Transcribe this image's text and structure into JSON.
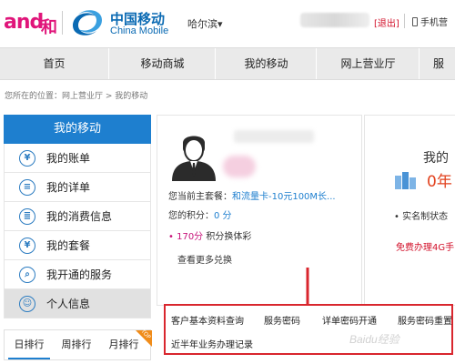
{
  "header": {
    "and_logo": "and",
    "he_text": "和",
    "brand_cn": "中国移动",
    "brand_en": "China Mobile",
    "city": "哈尔滨",
    "city_caret": "▾",
    "logout": "[退出]",
    "phone_link": "手机营"
  },
  "nav": {
    "items": [
      "首页",
      "移动商城",
      "我的移动",
      "网上营业厅",
      "服"
    ]
  },
  "breadcrumb": "您所在的位置：网上营业厅 > 我的移动",
  "sidebar": {
    "title": "我的移动",
    "items": [
      {
        "label": "我的账单",
        "icon": "yen-icon",
        "glyph": "¥"
      },
      {
        "label": "我的详单",
        "icon": "list-icon",
        "glyph": "≡"
      },
      {
        "label": "我的消费信息",
        "icon": "receipt-icon",
        "glyph": "≣"
      },
      {
        "label": "我的套餐",
        "icon": "yen-icon",
        "glyph": "¥"
      },
      {
        "label": "我开通的服务",
        "icon": "search-icon",
        "glyph": "⌕"
      },
      {
        "label": "个人信息",
        "icon": "user-icon",
        "glyph": "☺"
      }
    ],
    "rank_tabs": [
      "日排行",
      "周排行",
      "月排行"
    ],
    "top_badge": "TOP"
  },
  "profile": {
    "plan_label": "您当前主套餐：",
    "plan_value": "和流量卡-10元100M长...",
    "score_label": "您的积分：",
    "score_value": "0 分",
    "redeem_bullet": "•",
    "redeem_count": "170分",
    "redeem_text": " 积分换体彩",
    "more": "查看更多兑换"
  },
  "right_card": {
    "title": "我的",
    "big": "0年",
    "auth": "• 实名制状态",
    "free": "免费办理4G手"
  },
  "popup": {
    "items": [
      "客户基本资料查询",
      "服务密码",
      "详单密码开通",
      "服务密码重置",
      "近半年业务办理记录"
    ]
  },
  "watermark": "Baidu经验",
  "colors": {
    "brand_blue": "#1e7fcf",
    "logo_pink": "#e0157a",
    "alert_red": "#d2102a",
    "popup_border": "#d9262e"
  }
}
